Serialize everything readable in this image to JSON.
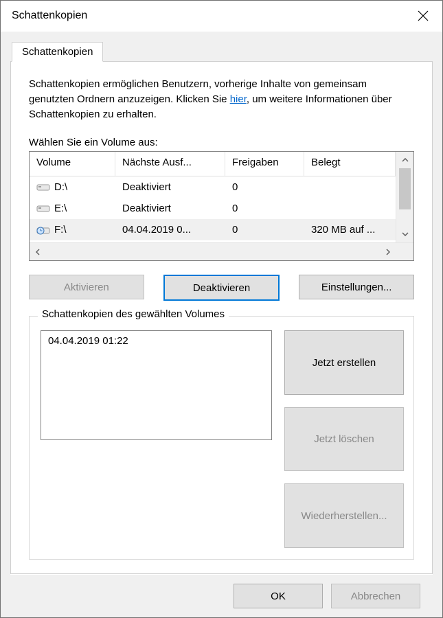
{
  "window": {
    "title": "Schattenkopien"
  },
  "tab": {
    "label": "Schattenkopien"
  },
  "intro": {
    "line1": "Schattenkopien ermöglichen Benutzern, vorherige Inhalte von gemeinsam genutzten Ordnern anzuzeigen. Klicken Sie ",
    "link": "hier",
    "line2": ", um weitere Informationen über Schattenkopien zu erhalten."
  },
  "select_volume_label": "Wählen Sie ein Volume aus:",
  "volume_table": {
    "headers": {
      "volume": "Volume",
      "next_run": "Nächste Ausf...",
      "shares": "Freigaben",
      "used": "Belegt"
    },
    "rows": [
      {
        "volume": "D:\\",
        "next_run": "Deaktiviert",
        "shares": "0",
        "used": "",
        "selected": false,
        "icon": "drive"
      },
      {
        "volume": "E:\\",
        "next_run": "Deaktiviert",
        "shares": "0",
        "used": "",
        "selected": false,
        "icon": "drive"
      },
      {
        "volume": "F:\\",
        "next_run": "04.04.2019 0...",
        "shares": "0",
        "used": "320 MB auf ...",
        "selected": true,
        "icon": "drive-clock"
      }
    ]
  },
  "buttons": {
    "activate": "Aktivieren",
    "deactivate": "Deaktivieren",
    "settings": "Einstellungen..."
  },
  "groupbox": {
    "title": "Schattenkopien des gewählten Volumes",
    "copies": [
      "04.04.2019 01:22"
    ],
    "create_now": "Jetzt erstellen",
    "delete_now": "Jetzt löschen",
    "restore": "Wiederherstellen..."
  },
  "footer": {
    "ok": "OK",
    "cancel": "Abbrechen"
  }
}
